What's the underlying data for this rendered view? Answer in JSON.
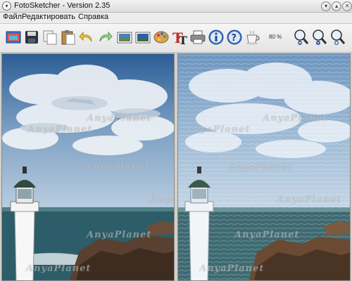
{
  "window": {
    "title": "FotoSketcher - Version 2.35",
    "menu_glyph": "▾"
  },
  "menu": {
    "items": [
      "Файл",
      "Редактировать",
      "Справка"
    ]
  },
  "toolbar": {
    "zoom_level": "80 %",
    "buttons": [
      "open-image-icon",
      "save-icon",
      "copy-icon",
      "paste-icon",
      "undo-icon",
      "redo-icon",
      "original-image-icon",
      "result-image-icon",
      "palette-icon",
      "text-icon",
      "print-icon",
      "info-icon",
      "help-icon",
      "coffee-icon",
      "zoom-out-icon",
      "zoom-reset-icon",
      "zoom-in-icon"
    ]
  },
  "panels": {
    "watermark": "AnyaPlanet"
  },
  "colors": {
    "sky_top": "#2f6fb3",
    "sky_bottom": "#a9c3dc",
    "sea": "#2b5b66",
    "rock": "#5a4030",
    "painted_sky": "#7fa8cc"
  }
}
